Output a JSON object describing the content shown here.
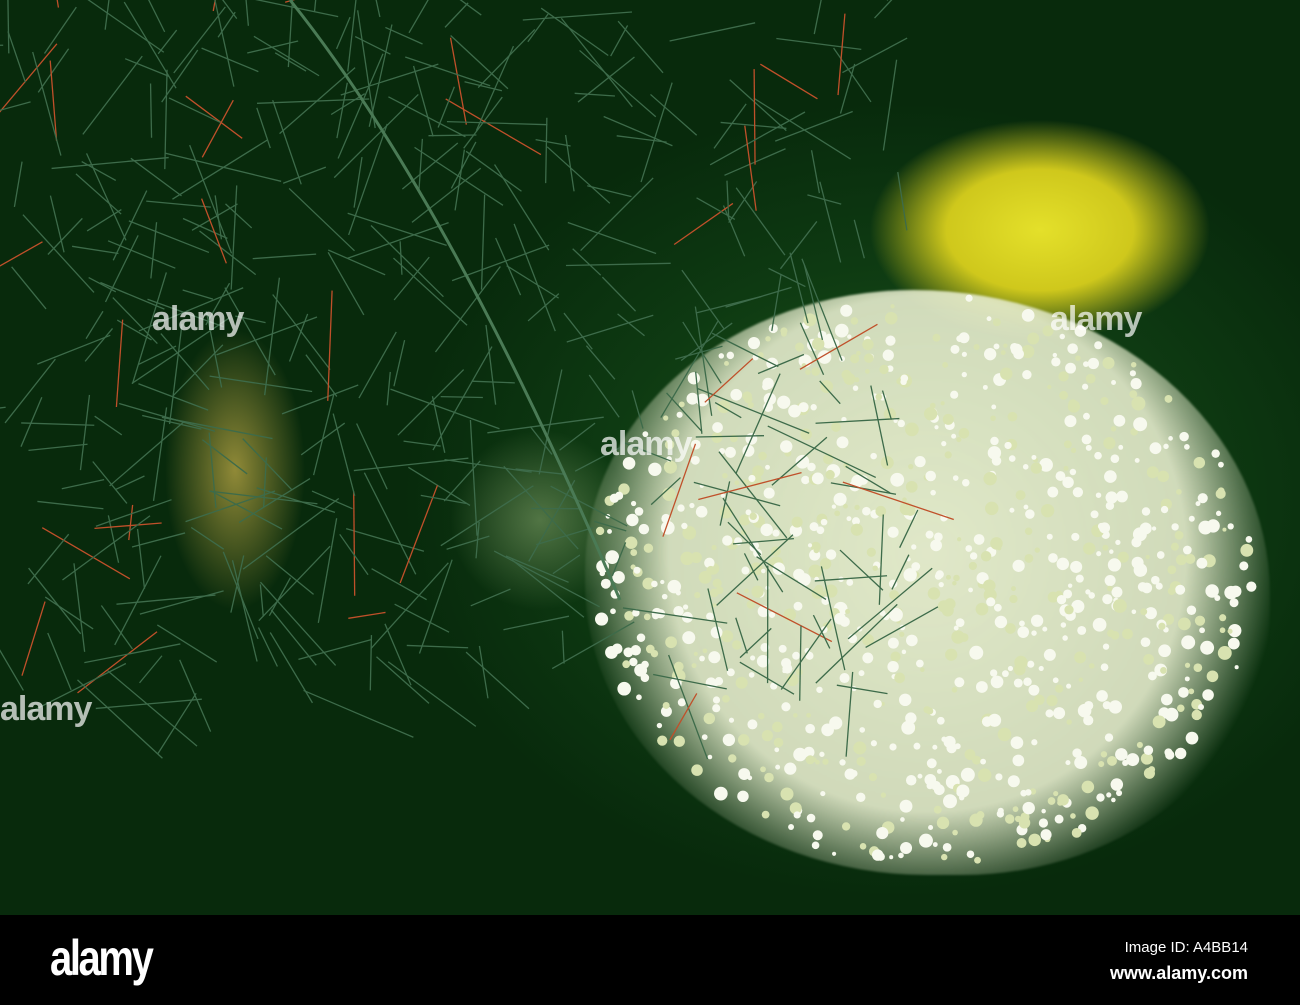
{
  "watermark": {
    "text": "alamy"
  },
  "footer": {
    "logo": "alamy",
    "image_id": "Image ID: A4BB14",
    "website": "www.alamy.com"
  }
}
